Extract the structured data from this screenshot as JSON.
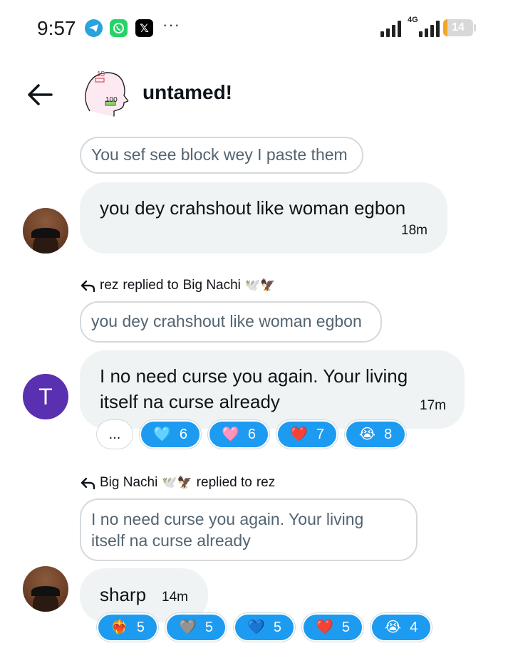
{
  "status_bar": {
    "time": "9:57",
    "more": "···",
    "network": "4G",
    "battery": "14",
    "battery_level": 0.14,
    "icons": [
      "telegram-icon",
      "whatsapp-icon",
      "x-icon",
      "signal-icon",
      "signal-4g-icon",
      "battery-icon"
    ]
  },
  "header": {
    "title": "untamed!",
    "avatar_badge_top": "15",
    "avatar_badge_bottom": "100"
  },
  "colors": {
    "accent": "#1d9bf0",
    "bubble": "#eff3f4",
    "avatar_letter_bg": "#5930b0",
    "battery": "#f5a623"
  },
  "messages": [
    {
      "quote": "You sef see block wey I paste them",
      "text": "you dey crahshout like woman egbon",
      "time": "18m",
      "avatar": "photo"
    },
    {
      "reply_from": "rez",
      "reply_mid": "replied to",
      "reply_to": "Big Nachi",
      "reply_to_emoji": "🕊️🦅",
      "quote": "you dey crahshout like woman egbon",
      "text_line1": "I no need curse you again. Your living",
      "text_line2": "itself na curse already",
      "time": "17m",
      "avatar_letter": "T",
      "more_reactions": "...",
      "reactions": [
        {
          "emoji": "🩵",
          "count": "6"
        },
        {
          "emoji": "🩷",
          "count": "6"
        },
        {
          "emoji": "❤️",
          "count": "7"
        },
        {
          "emoji": "😭",
          "count": "8"
        }
      ]
    },
    {
      "reply_from": "Big Nachi",
      "reply_from_emoji": "🕊️🦅",
      "reply_mid": "replied to",
      "reply_to": "rez",
      "quote_line1": "I no need curse you again. Your living",
      "quote_line2": "itself na curse already",
      "text": "sharp",
      "time": "14m",
      "avatar": "photo",
      "reactions": [
        {
          "emoji": "❤️‍🔥",
          "count": "5"
        },
        {
          "emoji": "🩶",
          "count": "5"
        },
        {
          "emoji": "💙",
          "count": "5"
        },
        {
          "emoji": "❤️",
          "count": "5"
        },
        {
          "emoji": "😭",
          "count": "4"
        }
      ]
    }
  ]
}
